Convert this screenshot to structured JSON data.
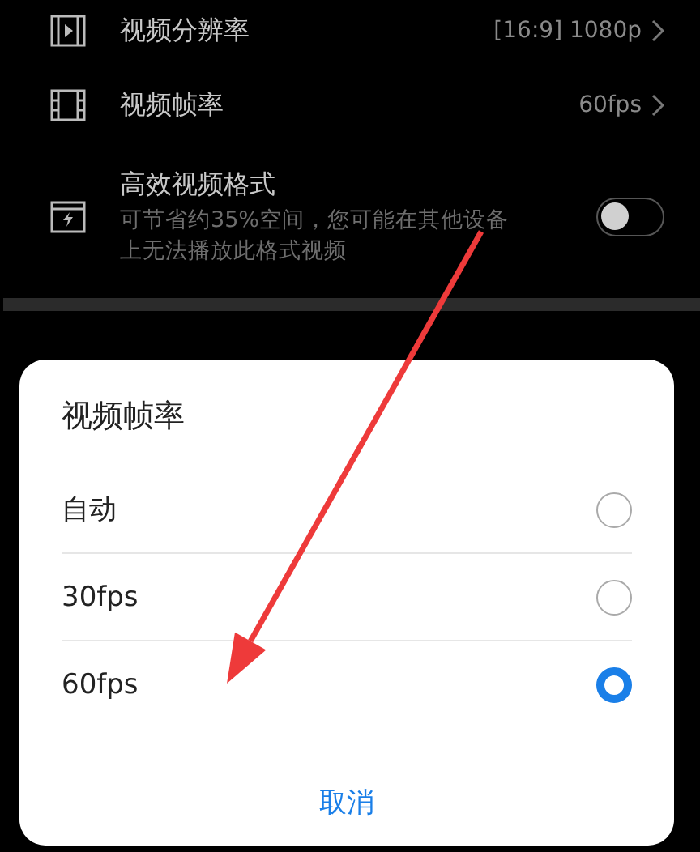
{
  "settings": [
    {
      "kind": "link",
      "title": "视频分辨率",
      "value": "[16:9] 1080p"
    },
    {
      "kind": "link",
      "title": "视频帧率",
      "value": "60fps"
    },
    {
      "kind": "switch",
      "title": "高效视频格式",
      "description": "可节省约35%空间，您可能在其他设备上无法播放此格式视频",
      "on": false
    }
  ],
  "dialog": {
    "title": "视频帧率",
    "options": [
      {
        "label": "自动",
        "selected": false
      },
      {
        "label": "30fps",
        "selected": false
      },
      {
        "label": "60fps",
        "selected": true
      }
    ],
    "cancel": "取消"
  }
}
